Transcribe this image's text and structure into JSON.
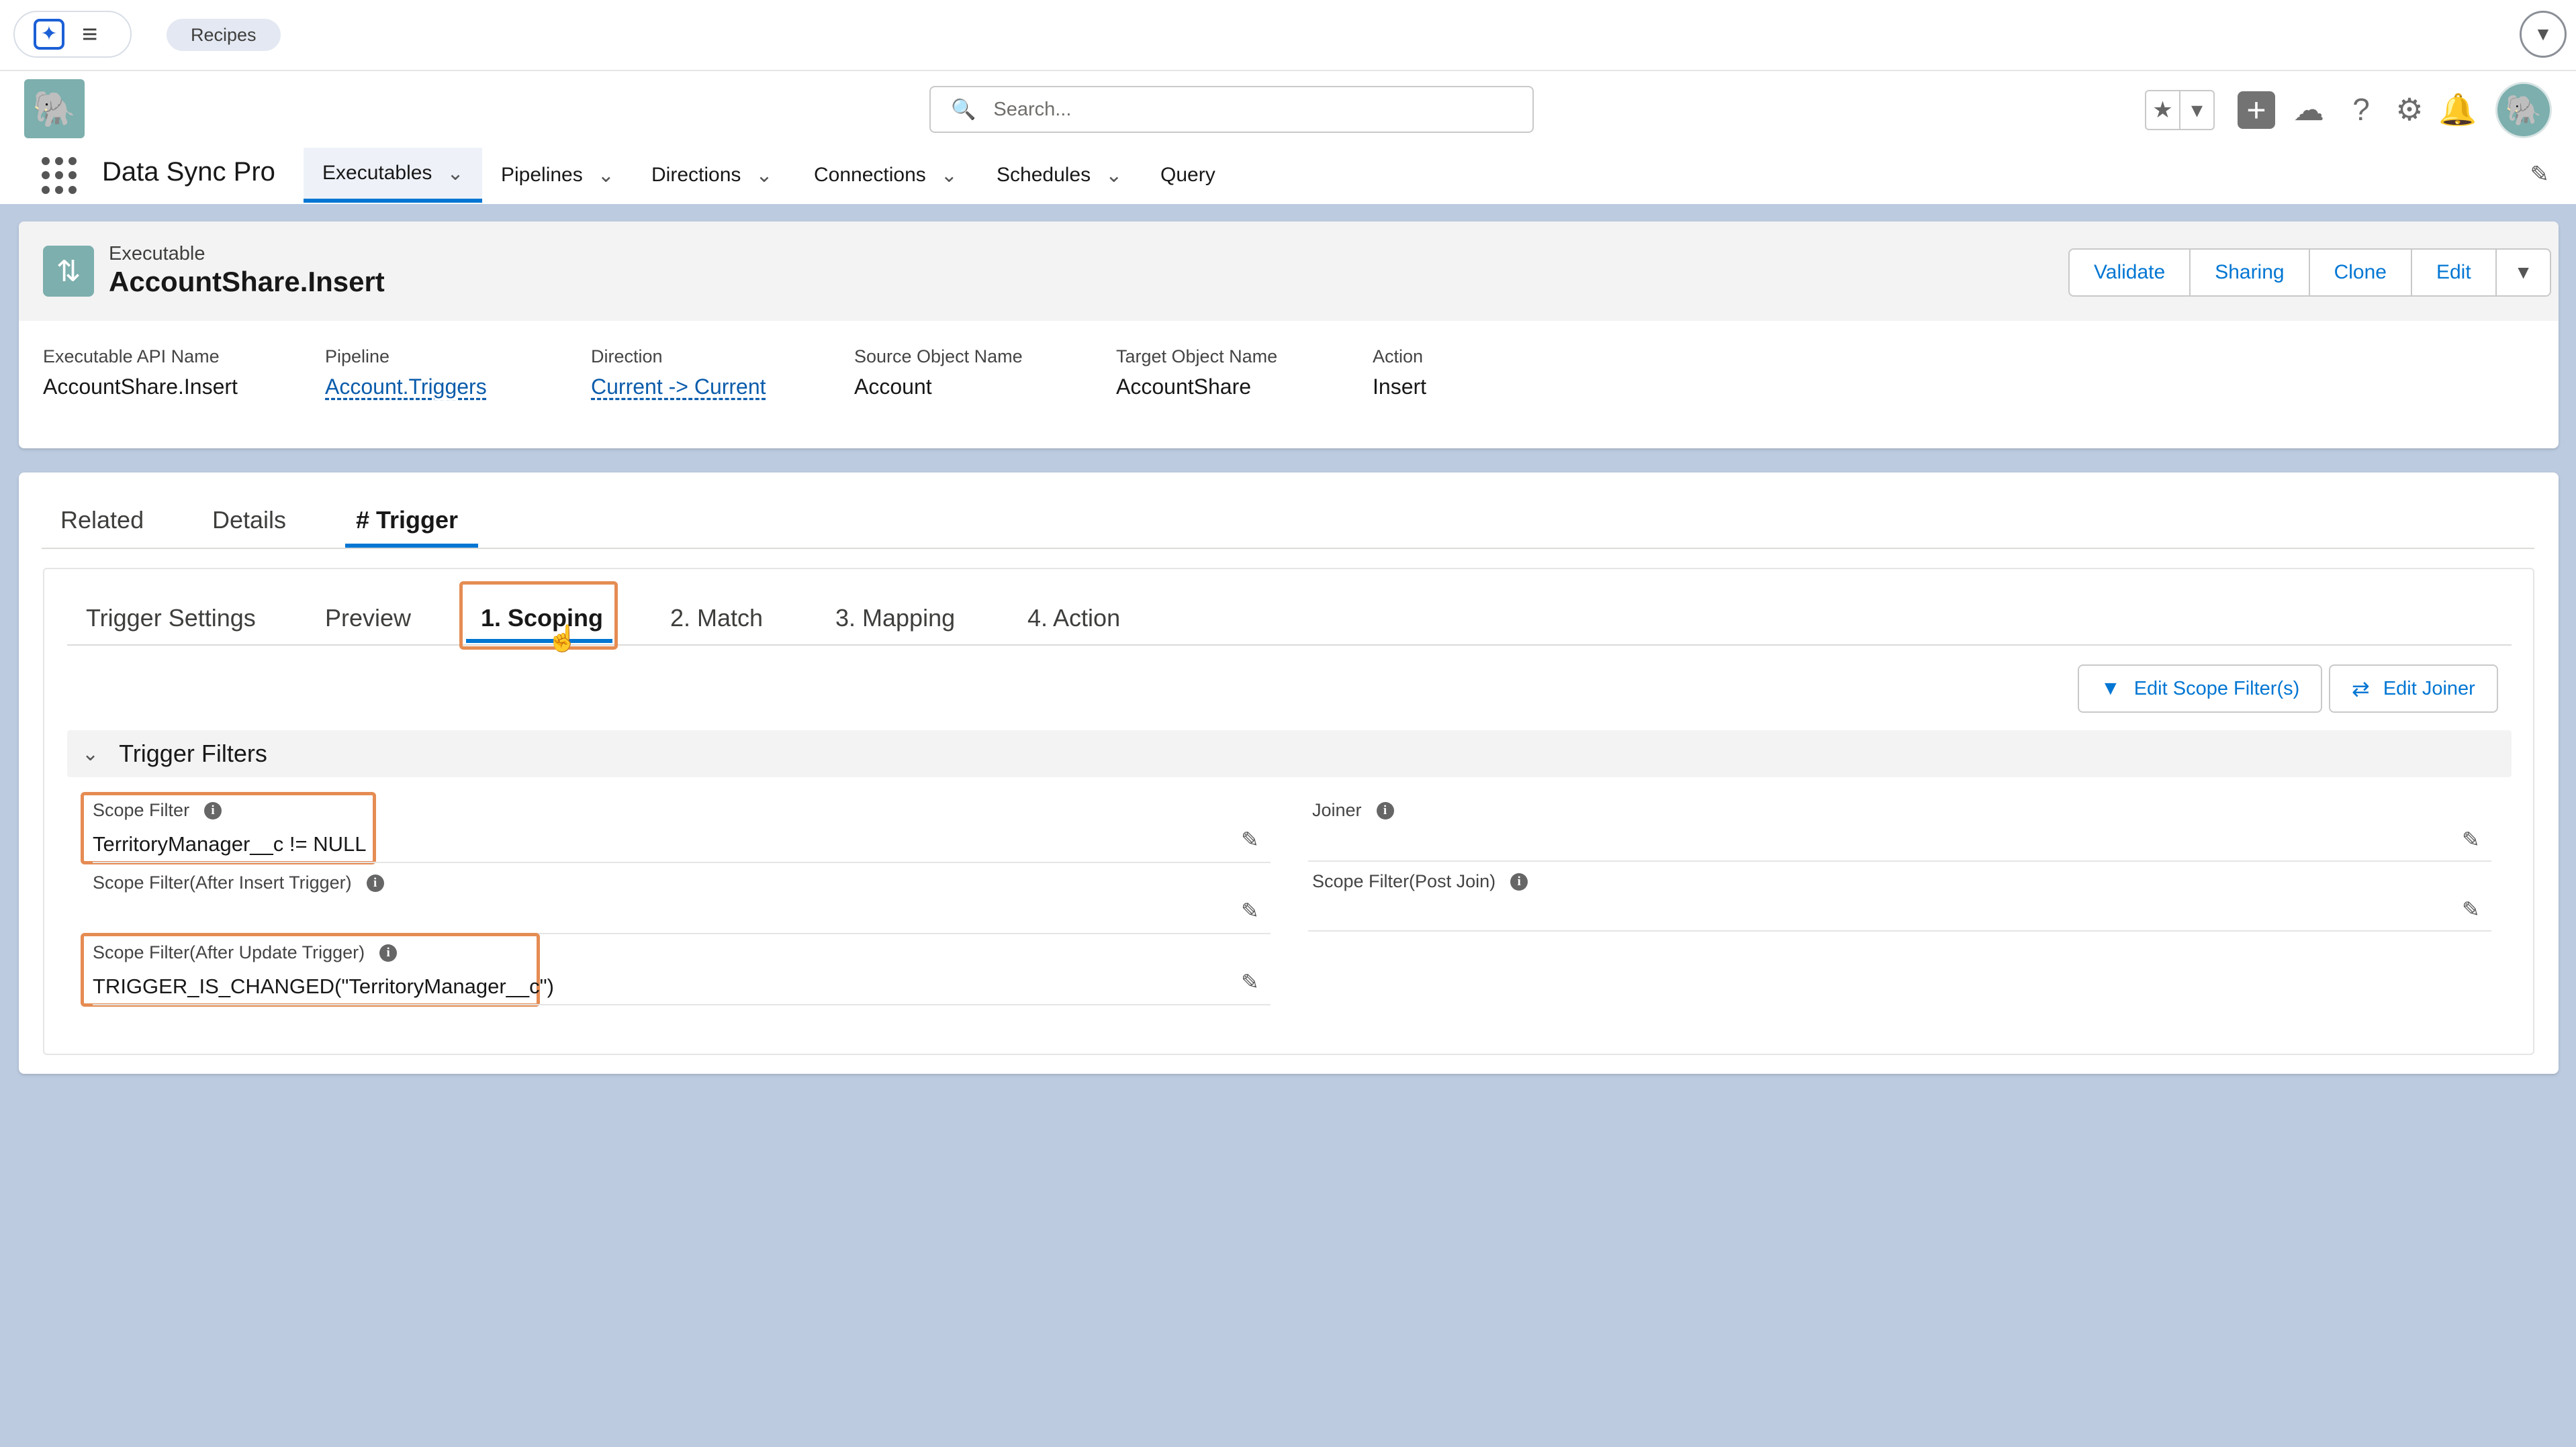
{
  "topbar": {
    "recipes_label": "Recipes"
  },
  "header": {
    "search_placeholder": "Search...",
    "app_name": "Data Sync Pro",
    "nav_tabs": [
      {
        "label": "Executables"
      },
      {
        "label": "Pipelines"
      },
      {
        "label": "Directions"
      },
      {
        "label": "Connections"
      },
      {
        "label": "Schedules"
      },
      {
        "label": "Query"
      }
    ]
  },
  "record": {
    "type_label": "Executable",
    "name": "AccountShare.Insert",
    "actions": {
      "validate": "Validate",
      "sharing": "Sharing",
      "clone": "Clone",
      "edit": "Edit"
    },
    "fields": [
      {
        "label": "Executable API Name",
        "value": "AccountShare.Insert"
      },
      {
        "label": "Pipeline",
        "value": "Account.Triggers"
      },
      {
        "label": "Direction",
        "value": "Current -> Current"
      },
      {
        "label": "Source Object Name",
        "value": "Account"
      },
      {
        "label": "Target Object Name",
        "value": "AccountShare"
      },
      {
        "label": "Action",
        "value": "Insert"
      }
    ]
  },
  "main_tabs": [
    {
      "label": "Related"
    },
    {
      "label": "Details"
    },
    {
      "label": "# Trigger"
    }
  ],
  "sub_tabs": [
    {
      "label": "Trigger Settings"
    },
    {
      "label": "Preview"
    },
    {
      "label": "1. Scoping"
    },
    {
      "label": "2. Match"
    },
    {
      "label": "3. Mapping"
    },
    {
      "label": "4. Action"
    }
  ],
  "toolbar": {
    "edit_scope_filters": "Edit Scope Filter(s)",
    "edit_joiner": "Edit Joiner"
  },
  "section": {
    "title": "Trigger Filters",
    "left": [
      {
        "label": "Scope Filter",
        "value": "TerritoryManager__c != NULL"
      },
      {
        "label": "Scope Filter(After Insert Trigger)",
        "value": ""
      },
      {
        "label": "Scope Filter(After Update Trigger)",
        "value": "TRIGGER_IS_CHANGED(\"TerritoryManager__c\")"
      }
    ],
    "right": [
      {
        "label": "Joiner",
        "value": ""
      },
      {
        "label": "Scope Filter(Post Join)",
        "value": ""
      }
    ]
  },
  "colors": {
    "brand_blue": "#0176d3",
    "highlight_orange": "#e58c53",
    "page_background": "#bccbe0",
    "app_icon_teal": "#7cafad"
  },
  "icons": [
    "launcher-icon",
    "menu-icon",
    "chevron-down-icon",
    "search-icon",
    "star-icon",
    "plus-icon",
    "cloud-icon",
    "help-icon",
    "gear-icon",
    "bell-icon",
    "waffle-icon",
    "pencil-icon",
    "filter-icon",
    "joiner-icon",
    "info-icon",
    "cursor-icon"
  ]
}
